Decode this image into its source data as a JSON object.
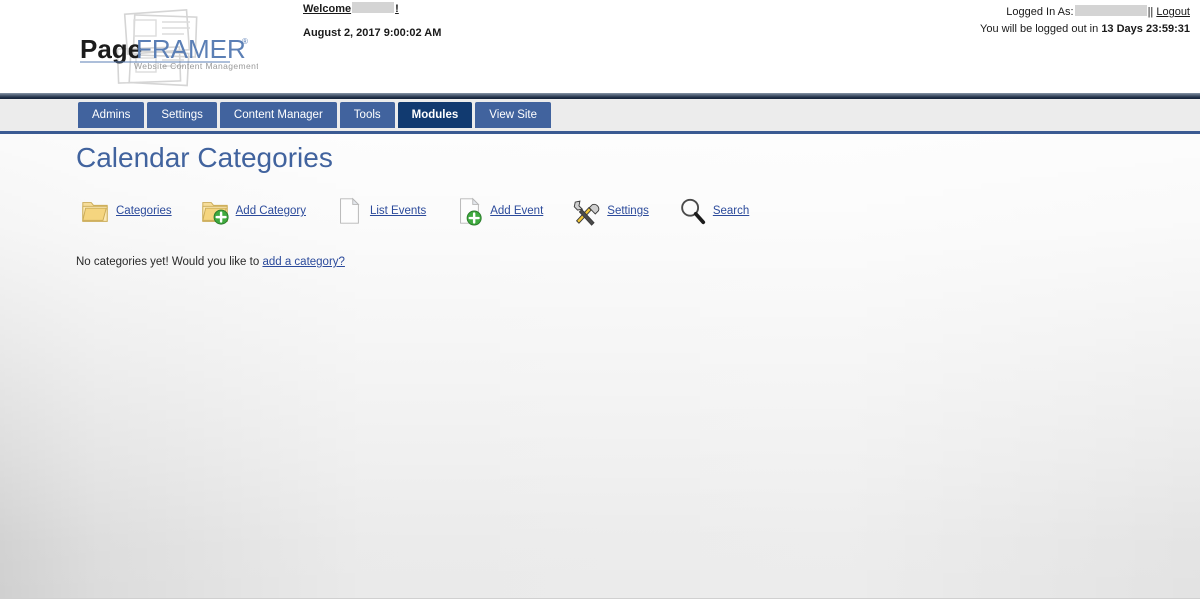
{
  "header": {
    "logo": {
      "name": "PageFRAMER",
      "part_bold": "Page",
      "part_light": "FRAMER",
      "registered_mark": "®",
      "tagline": "Website Content Management"
    },
    "welcome": {
      "label": "Welcome",
      "redacted_username": "",
      "suffix": "!"
    },
    "datetime": "August 2, 2017 9:00:02 AM",
    "login": {
      "logged_in_as_label": "Logged In As:",
      "redacted_username": "",
      "separator": "||",
      "logout_label": "Logout"
    },
    "session": {
      "prefix": "You will be logged out in",
      "remaining": "13 Days 23:59:31"
    }
  },
  "nav": {
    "tabs": [
      {
        "label": "Admins",
        "active": false
      },
      {
        "label": "Settings",
        "active": false
      },
      {
        "label": "Content Manager",
        "active": false
      },
      {
        "label": "Tools",
        "active": false
      },
      {
        "label": "Modules",
        "active": true
      },
      {
        "label": "View Site",
        "active": false
      }
    ]
  },
  "main": {
    "page_title": "Calendar Categories",
    "toolbar": [
      {
        "label": "Categories",
        "icon": "folder-icon"
      },
      {
        "label": "Add Category",
        "icon": "folder-add-icon"
      },
      {
        "label": "List Events",
        "icon": "page-icon"
      },
      {
        "label": "Add Event",
        "icon": "page-add-icon"
      },
      {
        "label": "Settings",
        "icon": "tools-icon"
      },
      {
        "label": "Search",
        "icon": "magnifier-icon"
      }
    ],
    "empty_state": {
      "text": "No categories yet! Would you like to",
      "link_label": "add a category?"
    }
  },
  "colors": {
    "tab_blue": "#41639e",
    "tab_active_blue": "#113a70",
    "title_blue": "#41639e",
    "link_blue": "#2b4a9b",
    "nav_divider": "#3a5a92",
    "page_bg": "#d0d0d0",
    "folder_yellow": "#f2d27a",
    "plus_green": "#3faa3f"
  }
}
